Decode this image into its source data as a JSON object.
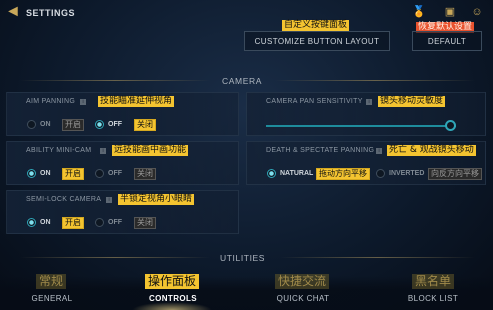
{
  "header": {
    "title": "SETTINGS",
    "customize_button": "CUSTOMIZE BUTTON LAYOUT",
    "default_button": "DEFAULT",
    "annotation_customize": "自定义按键面板",
    "annotation_default": "恢复默认设置",
    "icons": [
      "back-arrow-icon",
      "badge-icon",
      "friends-icon"
    ]
  },
  "camera": {
    "section_title": "CAMERA",
    "aim_panning": {
      "label": "AIM PANNING",
      "annotation": "技能瞄准延伸视角",
      "on_label": "ON",
      "on_tag": "开启",
      "off_label": "OFF",
      "off_tag": "关闭",
      "selected": "OFF"
    },
    "pan_sensitivity": {
      "label": "CAMERA PAN SENSITIVITY",
      "annotation": "镜头移动灵敏度",
      "value_fraction": 0.97
    },
    "ability_minicam": {
      "label": "ABILITY MINI-CAM",
      "annotation": "远技能画中画功能",
      "on_label": "ON",
      "on_tag": "开启",
      "off_label": "OFF",
      "off_tag": "关闭",
      "selected": "ON"
    },
    "death_panning": {
      "label": "DEATH & SPECTATE PANNING",
      "annotation": "死亡 & 观战镜头移动",
      "natural_label": "NATURAL",
      "natural_tag": "拖动方向平移",
      "inverted_label": "INVERTED",
      "inverted_tag": "向反方向平移",
      "selected": "NATURAL"
    },
    "semi_lock": {
      "label": "SEMI-LOCK CAMERA",
      "annotation": "半锁定视角小眼睛",
      "on_label": "ON",
      "on_tag": "开启",
      "off_label": "OFF",
      "off_tag": "关闭",
      "selected": "ON"
    }
  },
  "utilities": {
    "section_title": "UTILITIES"
  },
  "tabs": [
    {
      "label": "GENERAL",
      "annotation": "常规",
      "active": false
    },
    {
      "label": "CONTROLS",
      "annotation": "操作面板",
      "active": true
    },
    {
      "label": "QUICK CHAT",
      "annotation": "快捷交流",
      "active": false
    },
    {
      "label": "BLOCK LIST",
      "annotation": "黑名单",
      "active": false
    }
  ],
  "colors": {
    "accent": "#2fa6b8",
    "gold": "#c9a85a",
    "annotation_yellow": "#f4c430",
    "annotation_red": "#e8522e"
  }
}
